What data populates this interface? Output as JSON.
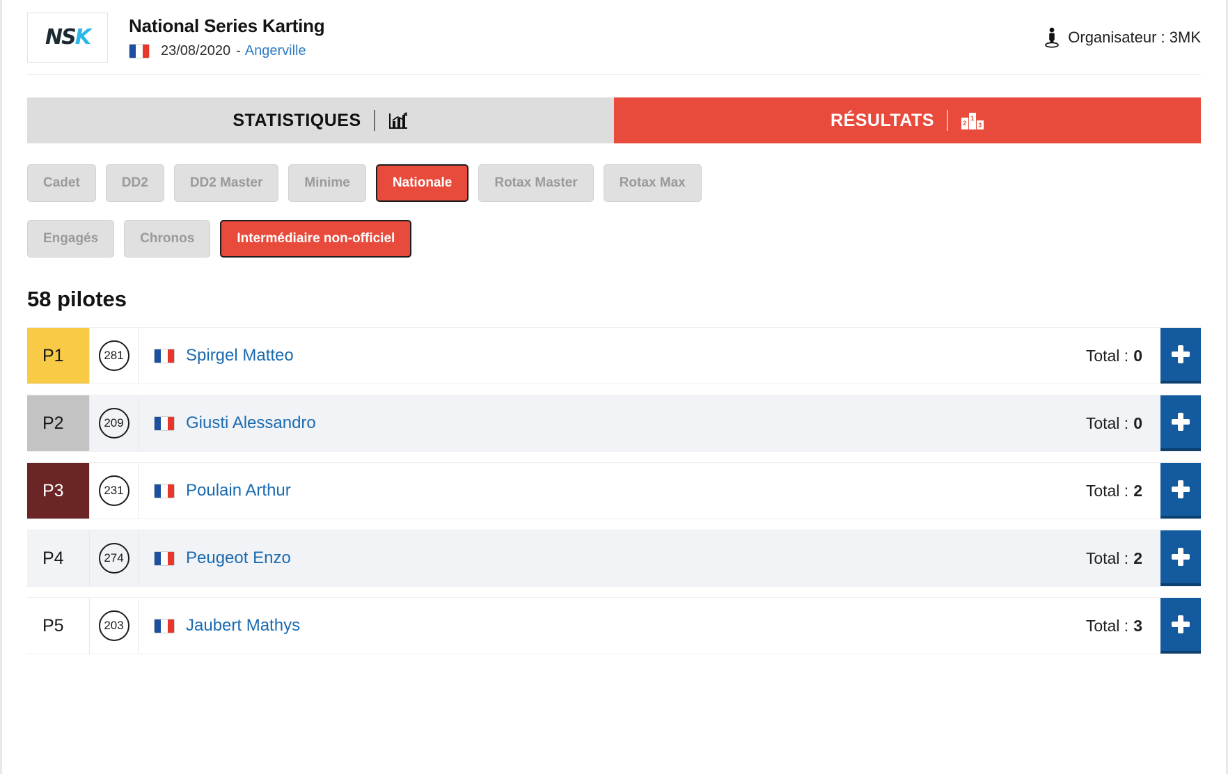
{
  "header": {
    "logo_ns": "NS",
    "logo_k": "K",
    "title": "National Series Karting",
    "date": "23/08/2020",
    "separator": "-",
    "location": "Angerville",
    "organiser": "Organisateur : 3MK",
    "organiser_icon": "person-podium-icon",
    "flag_icon": "france-flag-icon"
  },
  "tabs": [
    {
      "label": "STATISTIQUES",
      "icon": "bar-chart-icon",
      "active": false
    },
    {
      "label": "RÉSULTATS",
      "icon": "podium-icon",
      "active": true
    }
  ],
  "podium_icon_labels": {
    "second": "2",
    "first": "1",
    "third": "3"
  },
  "category_filters": [
    {
      "label": "Cadet",
      "active": false
    },
    {
      "label": "DD2",
      "active": false
    },
    {
      "label": "DD2 Master",
      "active": false
    },
    {
      "label": "Minime",
      "active": false
    },
    {
      "label": "Nationale",
      "active": true
    },
    {
      "label": "Rotax Master",
      "active": false
    },
    {
      "label": "Rotax Max",
      "active": false
    }
  ],
  "session_filters": [
    {
      "label": "Engagés",
      "active": false
    },
    {
      "label": "Chronos",
      "active": false
    },
    {
      "label": "Intermédiaire non-officiel",
      "active": true
    }
  ],
  "count_heading": "58 pilotes",
  "total_label": "Total :",
  "plus_label": "+",
  "colors": {
    "accent_red": "#e84b3c",
    "link_blue": "#1b6ab0",
    "plus_blue": "#135b9e",
    "gold": "#f8ca45",
    "silver": "#c3c3c3",
    "bronze": "#6b2525"
  },
  "rows": [
    {
      "pos": "P1",
      "medal": "gold",
      "number": "281",
      "name": "Spirgel Matteo",
      "total": "0",
      "alt": false
    },
    {
      "pos": "P2",
      "medal": "silver",
      "number": "209",
      "name": "Giusti Alessandro",
      "total": "0",
      "alt": true
    },
    {
      "pos": "P3",
      "medal": "bronze",
      "number": "231",
      "name": "Poulain Arthur",
      "total": "2",
      "alt": false
    },
    {
      "pos": "P4",
      "medal": "none",
      "number": "274",
      "name": "Peugeot Enzo",
      "total": "2",
      "alt": true
    },
    {
      "pos": "P5",
      "medal": "none",
      "number": "203",
      "name": "Jaubert Mathys",
      "total": "3",
      "alt": false
    }
  ]
}
